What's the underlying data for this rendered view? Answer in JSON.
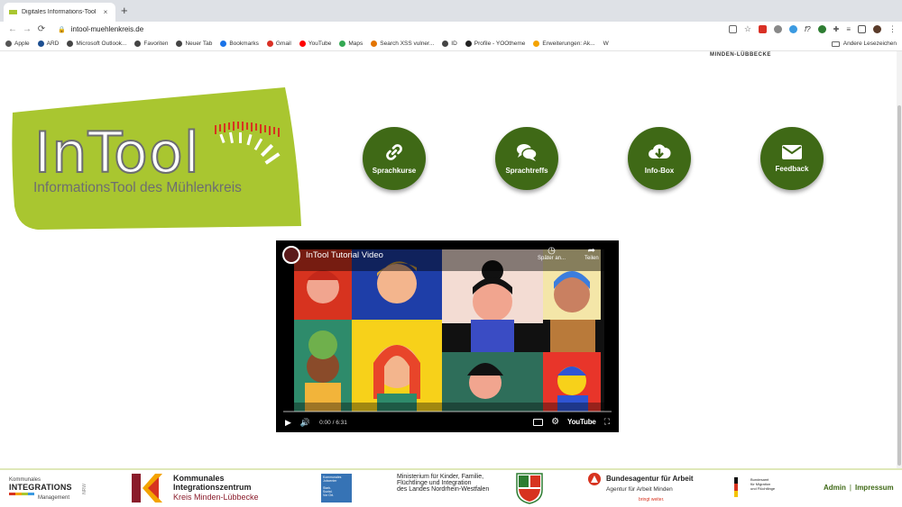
{
  "browser": {
    "tab_title": "Digitales Informations-Tool",
    "tab_close": "×",
    "new_tab": "+",
    "url": "intool-muehlenkreis.de",
    "bookmarks": [
      {
        "label": "Apple",
        "color": "#555555"
      },
      {
        "label": "ARD",
        "color": "#1d4f91"
      },
      {
        "label": "Microsoft Outlook...",
        "color": "#444444"
      },
      {
        "label": "Favoriten",
        "color": "#444444"
      },
      {
        "label": "Neuer Tab",
        "color": "#444444"
      },
      {
        "label": "Bookmarks",
        "color": "#1a73e8"
      },
      {
        "label": "Gmail",
        "color": "#d93025"
      },
      {
        "label": "YouTube",
        "color": "#ff0000"
      },
      {
        "label": "Maps",
        "color": "#34a853"
      },
      {
        "label": "Search XSS vulner...",
        "color": "#e37400"
      },
      {
        "label": "ID",
        "color": "#444444"
      },
      {
        "label": "Profile - YOOtheme",
        "color": "#222222"
      },
      {
        "label": "Erweiterungen: Ak...",
        "color": "#f4a300"
      },
      {
        "label": "W",
        "color": "#ffffff"
      }
    ],
    "other_bookmarks": "Andere Lesezeichen"
  },
  "page": {
    "top_label": "MINDEN-LÜBBECKE",
    "logo": {
      "title": "InTool",
      "subtitle": "InformationsTool des Mühlenkreis",
      "green": "#a9c630"
    },
    "buttons": [
      {
        "label": "Sprachkurse",
        "icon": "link-icon"
      },
      {
        "label": "Sprachtreffs",
        "icon": "chat-icon"
      },
      {
        "label": "Info-Box",
        "icon": "cloud-download-icon"
      },
      {
        "label": "Feedback",
        "icon": "envelope-icon"
      }
    ],
    "accent": "#3f6916",
    "video": {
      "title": "InTool Tutorial Video",
      "watch_later": "Später an...",
      "share": "Teilen",
      "time": "0:00 / 6:31",
      "youtube": "YouTube"
    }
  },
  "footer": {
    "logo1": {
      "top": "Kommunales",
      "main": "INTEGRATIONS",
      "bottom": "Management",
      "side": "NRW"
    },
    "logo2": {
      "line1": "Kommunales",
      "line2": "Integrationszentrum",
      "line3": "Kreis Minden-Lübbecke"
    },
    "logo3": {
      "line1": "Kommunales",
      "line2": "Jobcenter",
      "line3": "Stark.",
      "line4": "Sozial.",
      "line5": "Vor Ort."
    },
    "logo4": {
      "line1": "Ministerium für Kinder, Familie,",
      "line2": "Flüchtlinge und Integration",
      "line3": "des Landes Nordrhein-Westfalen"
    },
    "logo5": {
      "line1": "Bundesagentur für Arbeit",
      "line2": "Agentur für Arbeit Minden",
      "line3": "bringt weiter."
    },
    "logo6": {
      "line1": "Bundesamt",
      "line2": "für Migration",
      "line3": "und Flüchtlinge"
    },
    "admin": "Admin",
    "separator": "|",
    "impressum": "Impressum"
  }
}
